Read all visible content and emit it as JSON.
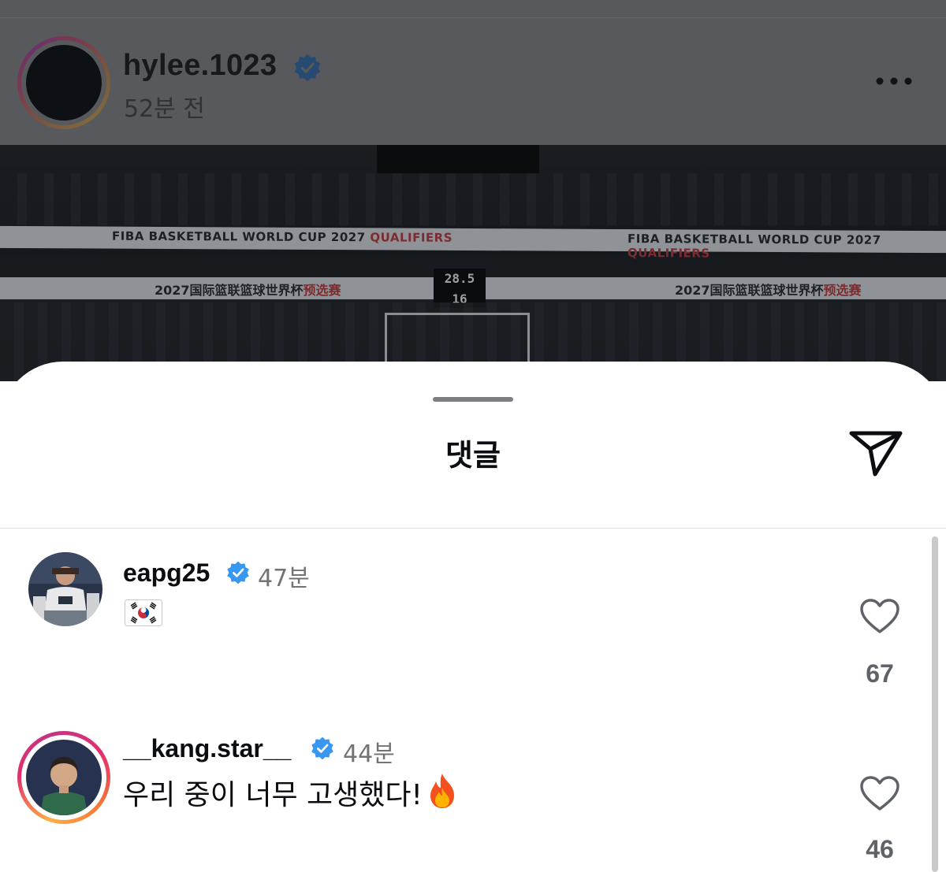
{
  "post": {
    "username": "hylee.1023",
    "time": "52분 전",
    "photo": {
      "banner_text": "FIBA BASKETBALL WORLD CUP 2027",
      "banner_highlight": "QUALIFIERS",
      "banner_cn": "2027国际篮联篮球世界杯",
      "banner_cn_highlight": "预选赛",
      "shot_clock": "28.5 16"
    }
  },
  "sheet": {
    "title": "댓글"
  },
  "comments": [
    {
      "username": "eapg25",
      "verified": true,
      "time": "47분",
      "text": "",
      "emoji": "korea-flag",
      "likes": "67"
    },
    {
      "username": "__kang.star__",
      "verified": true,
      "time": "44분",
      "text": "우리 중이 너무 고생했다!",
      "emoji": "fire",
      "likes": "46"
    }
  ],
  "icons": {
    "verified_color": "#3897f0"
  }
}
